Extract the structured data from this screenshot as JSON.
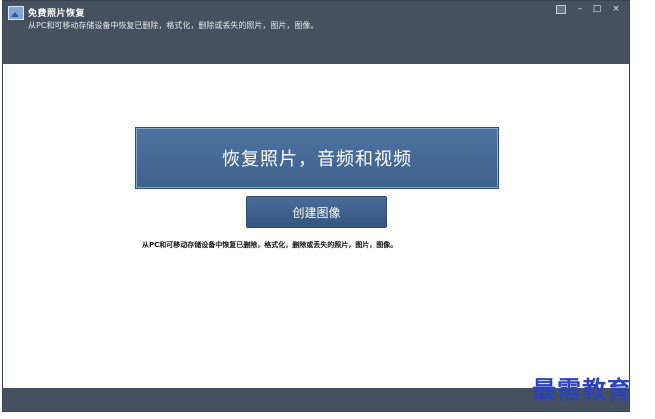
{
  "window": {
    "title": "免费照片恢复",
    "subtitle": "从PC和可移动存储设备中恢复已删除，格式化，删除或丢失的照片，图片，图像。",
    "controls": {
      "minimize": "–",
      "maximize": "□",
      "close": "×"
    }
  },
  "main": {
    "recover_button": "恢复照片，音频和视频",
    "create_image_button": "创建图像",
    "description": "从PC和可移动存储设备中恢复已删除，格式化，删除或丢失的照片，图片，图像。"
  },
  "watermark": "最需教育"
}
